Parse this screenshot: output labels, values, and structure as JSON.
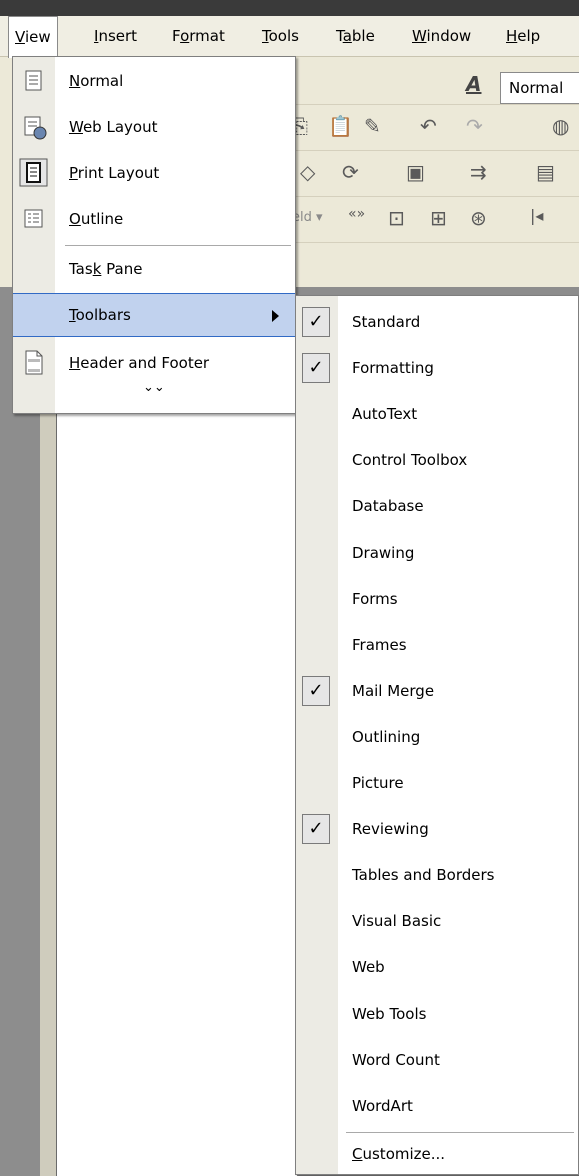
{
  "menubar": {
    "items": [
      {
        "pre": "",
        "u": "V",
        "post": "iew"
      },
      {
        "pre": "",
        "u": "I",
        "post": "nsert"
      },
      {
        "pre": "F",
        "u": "o",
        "post": "rmat"
      },
      {
        "pre": "",
        "u": "T",
        "post": "ools"
      },
      {
        "pre": "T",
        "u": "a",
        "post": "ble"
      },
      {
        "pre": "",
        "u": "W",
        "post": "indow"
      },
      {
        "pre": "",
        "u": "H",
        "post": "elp"
      }
    ]
  },
  "toolbar": {
    "style_value": "Normal",
    "field_fragment": "eld ▾"
  },
  "view_menu": {
    "items": [
      {
        "pre": "",
        "u": "N",
        "post": "ormal",
        "icon": "normal-view-icon"
      },
      {
        "pre": "",
        "u": "W",
        "post": "eb Layout",
        "icon": "web-layout-icon"
      },
      {
        "pre": "",
        "u": "P",
        "post": "rint Layout",
        "icon": "print-layout-icon"
      },
      {
        "pre": "",
        "u": "O",
        "post": "utline",
        "icon": "outline-view-icon"
      },
      {
        "pre": "Tas",
        "u": "k",
        "post": " Pane",
        "icon": ""
      },
      {
        "pre": "",
        "u": "T",
        "post": "oolbars",
        "icon": ""
      },
      {
        "pre": "",
        "u": "H",
        "post": "eader and Footer",
        "icon": "header-footer-icon"
      }
    ],
    "expand_glyph": "⌄⌄"
  },
  "toolbars_menu": {
    "items": [
      {
        "label": "Standard",
        "checked": true
      },
      {
        "label": "Formatting",
        "checked": true
      },
      {
        "label": "AutoText",
        "checked": false
      },
      {
        "label": "Control Toolbox",
        "checked": false
      },
      {
        "label": "Database",
        "checked": false
      },
      {
        "label": "Drawing",
        "checked": false
      },
      {
        "label": "Forms",
        "checked": false
      },
      {
        "label": "Frames",
        "checked": false
      },
      {
        "label": "Mail Merge",
        "checked": true
      },
      {
        "label": "Outlining",
        "checked": false
      },
      {
        "label": "Picture",
        "checked": false
      },
      {
        "label": "Reviewing",
        "checked": true
      },
      {
        "label": "Tables and Borders",
        "checked": false
      },
      {
        "label": "Visual Basic",
        "checked": false
      },
      {
        "label": "Web",
        "checked": false
      },
      {
        "label": "Web Tools",
        "checked": false
      },
      {
        "label": "Word Count",
        "checked": false
      },
      {
        "label": "WordArt",
        "checked": false
      }
    ],
    "customize": {
      "pre": "",
      "u": "C",
      "post": "ustomize..."
    }
  },
  "colors": {
    "highlight": "#c1d2ee",
    "highlight_border": "#316ac5",
    "icon_column": "#ecebe4"
  }
}
